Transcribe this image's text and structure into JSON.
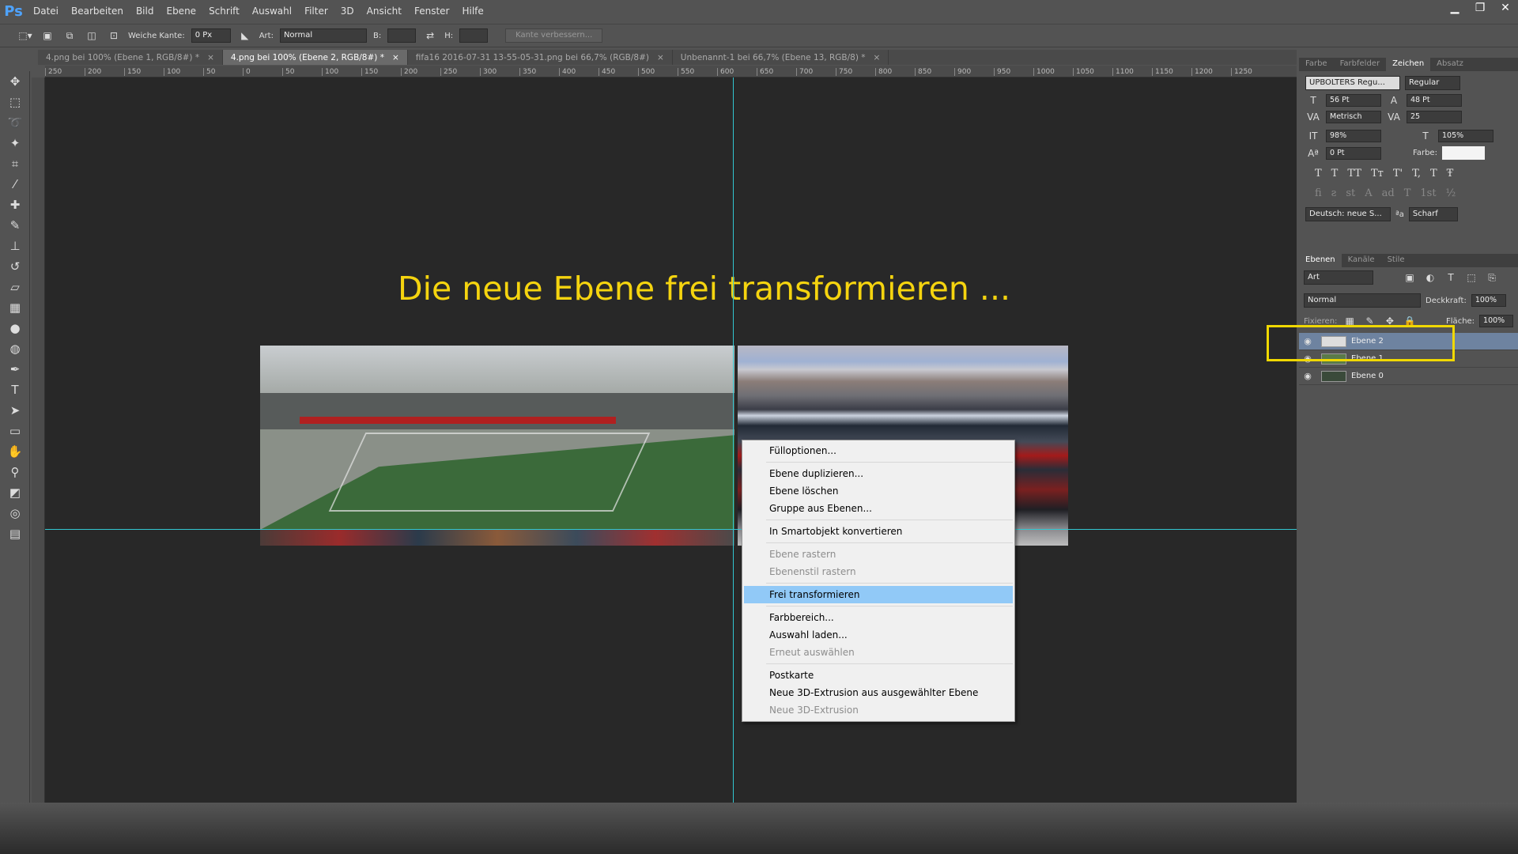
{
  "app": {
    "logo": "Ps"
  },
  "menu": [
    "Datei",
    "Bearbeiten",
    "Bild",
    "Ebene",
    "Schrift",
    "Auswahl",
    "Filter",
    "3D",
    "Ansicht",
    "Fenster",
    "Hilfe"
  ],
  "options": {
    "feather_label": "Weiche Kante:",
    "feather_value": "0 Px",
    "style_label": "Art:",
    "style_value": "Normal",
    "width_label": "B:",
    "height_label": "H:",
    "refine_button": "Kante verbessern..."
  },
  "tabs": [
    {
      "label": "4.png bei 100% (Ebene 1, RGB/8#) *"
    },
    {
      "label": "4.png bei 100% (Ebene 2, RGB/8#) *"
    },
    {
      "label": "fifa16 2016-07-31 13-55-05-31.png bei 66,7% (RGB/8#)"
    },
    {
      "label": "Unbenannt-1 bei 66,7% (Ebene 13, RGB/8) *"
    }
  ],
  "ruler_ticks": [
    "250",
    "200",
    "150",
    "100",
    "50",
    "0",
    "50",
    "100",
    "150",
    "200",
    "250",
    "300",
    "350",
    "400",
    "450",
    "500",
    "550",
    "600",
    "650",
    "700",
    "750",
    "800",
    "850",
    "900",
    "950",
    "1000",
    "1050",
    "1100",
    "1150",
    "1200",
    "1250"
  ],
  "headline": "Die neue Ebene frei transformieren ...",
  "context_menu": {
    "items": [
      {
        "label": "Fülloptionen...",
        "disabled": false,
        "selected": false,
        "sep_after": true
      },
      {
        "label": "Ebene duplizieren...",
        "disabled": false,
        "selected": false,
        "sep_after": false
      },
      {
        "label": "Ebene löschen",
        "disabled": false,
        "selected": false,
        "sep_after": false
      },
      {
        "label": "Gruppe aus Ebenen...",
        "disabled": false,
        "selected": false,
        "sep_after": true
      },
      {
        "label": "In Smartobjekt konvertieren",
        "disabled": false,
        "selected": false,
        "sep_after": true
      },
      {
        "label": "Ebene rastern",
        "disabled": true,
        "selected": false,
        "sep_after": false
      },
      {
        "label": "Ebenenstil rastern",
        "disabled": true,
        "selected": false,
        "sep_after": true
      },
      {
        "label": "Frei transformieren",
        "disabled": false,
        "selected": true,
        "sep_after": true
      },
      {
        "label": "Farbbereich...",
        "disabled": false,
        "selected": false,
        "sep_after": false
      },
      {
        "label": "Auswahl laden...",
        "disabled": false,
        "selected": false,
        "sep_after": false
      },
      {
        "label": "Erneut auswählen",
        "disabled": true,
        "selected": false,
        "sep_after": true
      },
      {
        "label": "Postkarte",
        "disabled": false,
        "selected": false,
        "sep_after": false
      },
      {
        "label": "Neue 3D-Extrusion aus ausgewählter Ebene",
        "disabled": false,
        "selected": false,
        "sep_after": false
      },
      {
        "label": "Neue 3D-Extrusion",
        "disabled": true,
        "selected": false,
        "sep_after": false
      }
    ]
  },
  "char_panel": {
    "tabs": [
      "Farbe",
      "Farbfelder",
      "Zeichen",
      "Absatz"
    ],
    "active_tab": "Zeichen",
    "font_family": "UPBOLTERS Regu...",
    "font_style": "Regular",
    "font_size": "56 Pt",
    "leading": "48 Pt",
    "kerning": "Metrisch",
    "tracking": "25",
    "vscale": "98%",
    "hscale": "105%",
    "baseline": "0 Pt",
    "color_label": "Farbe:",
    "language": "Deutsch: neue S...",
    "aa_label": "ªa",
    "antialias": "Scharf",
    "style_glyphs": [
      "T",
      "T",
      "TT",
      "Tт",
      "T'",
      "T,",
      "T",
      "Ŧ"
    ],
    "ot_glyphs": [
      "fi",
      "ƨ",
      "st",
      "A",
      "ad",
      "T",
      "1st",
      "½"
    ]
  },
  "layers_panel": {
    "tabs": [
      "Ebenen",
      "Kanäle",
      "Stile"
    ],
    "filter": "Art",
    "blend": "Normal",
    "opacity_label": "Deckkraft:",
    "opacity": "100%",
    "lock_label": "Fixieren:",
    "fill_label": "Fläche:",
    "fill": "100%",
    "layers": [
      {
        "name": "Ebene 2",
        "selected": true
      },
      {
        "name": "Ebene 1",
        "selected": false
      },
      {
        "name": "Ebene 0",
        "selected": false
      }
    ]
  },
  "colors": {
    "accent_yellow": "#f5d40f",
    "guide": "#32c6d0",
    "selection": "#91c9f7"
  }
}
